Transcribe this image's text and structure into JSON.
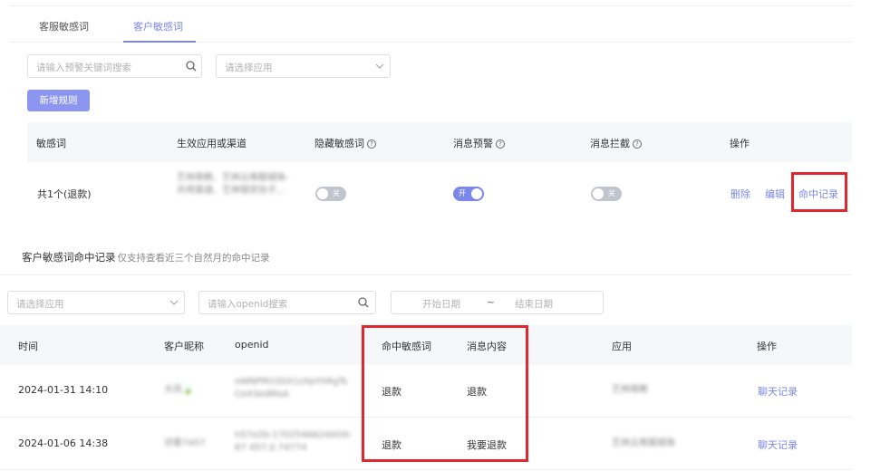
{
  "tabs": [
    {
      "label": "客服敏感词",
      "active": false
    },
    {
      "label": "客户敏感词",
      "active": true
    }
  ],
  "filters": {
    "keyword_placeholder": "请输入预警关键词搜索",
    "app_placeholder": "请选择应用"
  },
  "add_rule_label": "新增规则",
  "rules_table": {
    "headers": {
      "word": "敏感词",
      "apps": "生效应用或渠道",
      "hide": "隐藏敏感词",
      "warn": "消息预警",
      "block": "消息拦截",
      "ops": "操作"
    },
    "row": {
      "word": "共1个(退款)",
      "apps_blurred": "艺林萌教、艺林云南服城珠-共将渠道、艺林银宾协子...",
      "hide_state": "关",
      "warn_state": "开",
      "block_state": "关",
      "delete": "删除",
      "edit": "编辑",
      "hit_record": "命中记录"
    }
  },
  "records": {
    "title": "客户敏感词命中记录",
    "subtitle": "仅支持查看近三个自然月的命中记录",
    "app_placeholder": "请选择应用",
    "openid_placeholder": "请输入openid搜索",
    "start_date": "开始日期",
    "date_sep": "~",
    "end_date": "结束日期",
    "headers": {
      "time": "时间",
      "nick": "客户昵称",
      "openid": "openid",
      "word": "命中敏感词",
      "content": "消息内容",
      "app": "应用",
      "ops": "操作"
    },
    "rows": [
      {
        "time": "2024-01-31 14:10",
        "nick": "大风🍃",
        "openid": "oWNPM1SSX1zXpYhRgTs Ce43edMxA",
        "word": "退款",
        "content": "退款",
        "app": "艺林萌教",
        "op": "聊天记录"
      },
      {
        "time": "2024-01-06 14:38",
        "nick": "访客7457",
        "openid": "h57e2b-17025466240O0-67 457.0.74774",
        "word": "退款",
        "content": "我要退款",
        "app": "艺林云南服城珠",
        "op": "聊天记录"
      }
    ]
  },
  "colors": {
    "accent": "#7b87e8",
    "toggle_off": "#c0c4cc",
    "highlight": "#e0282e"
  }
}
